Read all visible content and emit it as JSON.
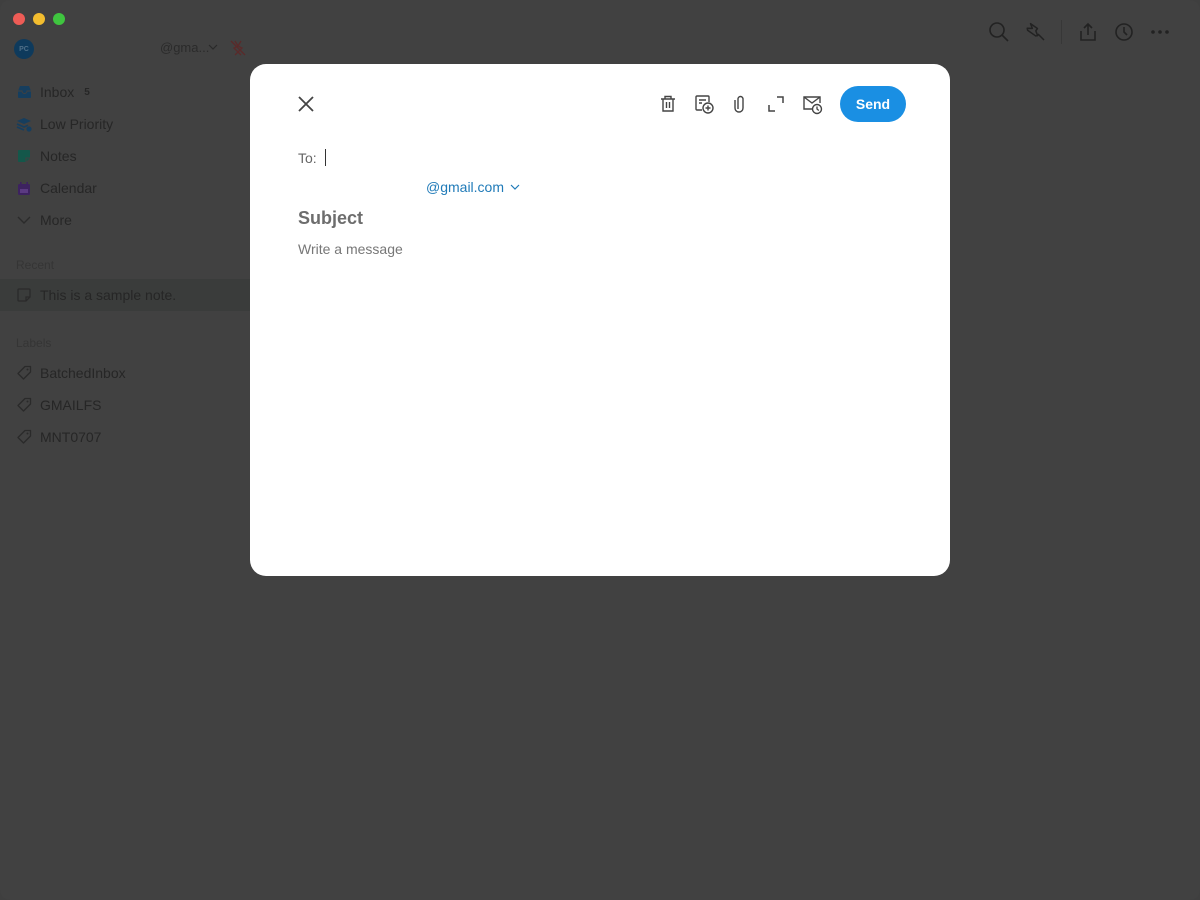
{
  "window": {
    "traffic_lights": [
      "close",
      "minimize",
      "maximize"
    ]
  },
  "sidebar": {
    "account": {
      "avatar_initials": "PC",
      "email": "@gma...",
      "status_icon": "offline-icon"
    },
    "nav_items": [
      {
        "label": "Inbox",
        "icon": "inbox-icon",
        "badge": "5"
      },
      {
        "label": "Low Priority",
        "icon": "low-priority-icon"
      },
      {
        "label": "Notes",
        "icon": "notes-icon"
      },
      {
        "label": "Calendar",
        "icon": "calendar-icon"
      },
      {
        "label": "More",
        "icon": "chevron-down-icon"
      }
    ],
    "recent": {
      "heading": "Recent",
      "items": [
        {
          "label": "This is a sample note.",
          "icon": "note-icon"
        }
      ]
    },
    "labels": {
      "heading": "Labels",
      "items": [
        {
          "label": "BatchedInbox",
          "icon": "tag-icon"
        },
        {
          "label": "GMAILFS",
          "icon": "tag-icon"
        },
        {
          "label": "MNT0707",
          "icon": "tag-icon"
        }
      ]
    }
  },
  "toolbar": {
    "buttons": [
      "search-icon",
      "pin-icon",
      "share-icon",
      "history-icon",
      "more-icon"
    ]
  },
  "compose": {
    "to_label": "To:",
    "to_value": "",
    "from_address": "@gmail.com",
    "subject_placeholder": "Subject",
    "message_placeholder": "Write a message",
    "actions": [
      "trash-icon",
      "add-to-calendar-icon",
      "attach-icon",
      "expand-icon",
      "schedule-send-icon"
    ],
    "send_label": "Send",
    "accent_color": "#1a8fe3"
  }
}
